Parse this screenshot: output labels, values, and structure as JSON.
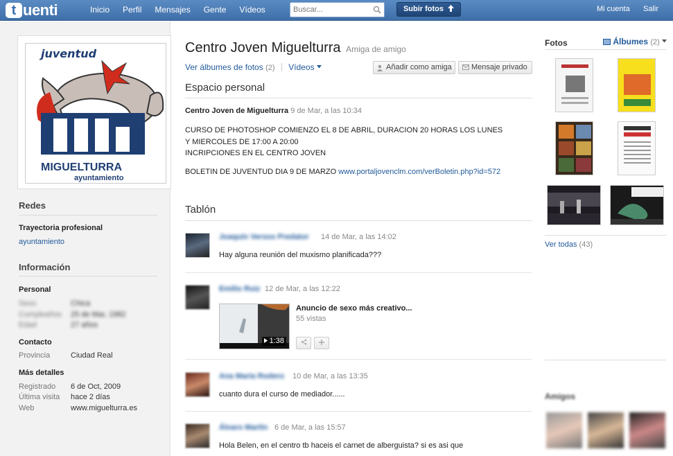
{
  "topbar": {
    "logo_t": "t",
    "logo_rest": "uenti",
    "nav": [
      "Inicio",
      "Perfil",
      "Mensajes",
      "Gente",
      "Vídeos"
    ],
    "search_placeholder": "Buscar...",
    "upload_label": "Subir fotos",
    "account": "Mi cuenta",
    "logout": "Salir"
  },
  "profile": {
    "name": "Centro Joven Miguelturra",
    "relation": "Amiga de amigo",
    "albums_link": "Ver álbumes de fotos",
    "albums_count": "(2)",
    "videos_link": "Vídeos",
    "add_friend": "Añadir como amiga",
    "private_message": "Mensaje privado",
    "avatar_top": "juventud",
    "avatar_brand": "MIGUELTURRA",
    "avatar_sub": "ayuntamiento"
  },
  "left": {
    "redes_title": "Redes",
    "trayectoria_title": "Trayectoria profesional",
    "trayectoria_value": "ayuntamiento",
    "info_title": "Información",
    "personal_title": "Personal",
    "personal": [
      {
        "k": "Sexo",
        "v": "Chica"
      },
      {
        "k": "Cumpleaños",
        "v": "25 de Mar, 1982"
      },
      {
        "k": "Edad",
        "v": "27 años"
      }
    ],
    "contacto_title": "Contacto",
    "provincia_k": "Provincia",
    "provincia_v": "Ciudad Real",
    "mas_title": "Más detalles",
    "mas": [
      {
        "k": "Registrado",
        "v": "6 de Oct, 2009"
      },
      {
        "k": "Última visita",
        "v": "hace 2 días"
      },
      {
        "k": "Web",
        "v": "www.miguelturra.es"
      }
    ]
  },
  "espacio": {
    "title": "Espacio personal",
    "author": "Centro Joven de Miguelturra",
    "timestamp": "9 de Mar, a las 10:34",
    "line1": "CURSO DE PHOTOSHOP COMIENZO EL 8 DE ABRIL, DURACION 20 HORAS LOS LUNES",
    "line2": "Y MIERCOLES DE 17:00 A 20:00",
    "line3": "INCRIPCIONES EN EL CENTRO JOVEN",
    "line4_text": "BOLETIN DE JUVENTUD DIA 9 DE MARZO ",
    "line4_link": "www.portaljovenclm.com/verBoletin.php?id=572"
  },
  "tablon": {
    "title": "Tablón",
    "posts": [
      {
        "author": "Joaquín Versos Predator",
        "date": "14 de Mar, a las 14:02",
        "text": "Hay alguna reunión del muxismo planificada???"
      },
      {
        "author": "Emilio Ruiz",
        "date": "12 de Mar, a las 12:22",
        "text": ""
      },
      {
        "author": "Ana María Rodero",
        "date": "10 de Mar, a las 13:35",
        "text": "cuanto dura el curso de mediador......"
      },
      {
        "author": "Álvaro Martín",
        "date": "6 de Mar, a las 15:57",
        "text": "Hola Belen, en el centro tb haceis el carnet de alberguista? si es asi que"
      }
    ],
    "video": {
      "title": "Anuncio de sexo más creativo...",
      "views": "55 vistas",
      "duration": "1:38"
    }
  },
  "right": {
    "fotos_title": "Fotos",
    "albums_label": "Álbumes",
    "albums_count": "(2)",
    "ver_todas": "Ver todas",
    "ver_todas_count": "(43)",
    "amigos_title": "Amigos"
  },
  "colors": {
    "topbar": "#4a7bb7",
    "link": "#225a9b",
    "upload_button": "#2a5189"
  }
}
